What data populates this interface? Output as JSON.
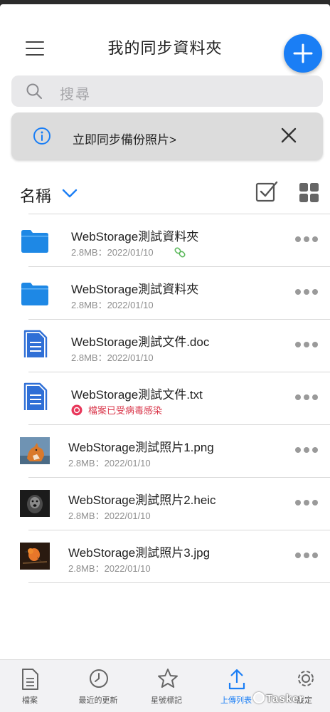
{
  "header": {
    "title": "我的同步資料夾"
  },
  "search": {
    "placeholder": "搜尋"
  },
  "banner": {
    "text": "立即同步備份照片>"
  },
  "sort": {
    "label": "名稱"
  },
  "files": [
    {
      "name": "WebStorage測試資料夾",
      "meta": "2.8MB：2022/01/10",
      "type": "folder",
      "shared": true
    },
    {
      "name": "WebStorage測試資料夾",
      "meta": "2.8MB：2022/01/10",
      "type": "folder",
      "shared": false
    },
    {
      "name": "WebStorage測試文件.doc",
      "meta": "2.8MB：2022/01/10",
      "type": "document"
    },
    {
      "name": "WebStorage測試文件.txt",
      "warning": "檔案已受病毒感染",
      "type": "document"
    },
    {
      "name": "WebStorage測試照片1.png",
      "meta": "2.8MB：2022/01/10",
      "type": "photo",
      "thumb": "fox"
    },
    {
      "name": "WebStorage測試照片2.heic",
      "meta": "2.8MB：2022/01/10",
      "type": "photo",
      "thumb": "dog"
    },
    {
      "name": "WebStorage測試照片3.jpg",
      "meta": "2.8MB：2022/01/10",
      "type": "photo",
      "thumb": "bird"
    }
  ],
  "nav": {
    "tabs": [
      {
        "label": "檔案",
        "icon": "document-icon"
      },
      {
        "label": "最近的更新",
        "icon": "clock-icon"
      },
      {
        "label": "星號標記",
        "icon": "star-icon"
      },
      {
        "label": "上傳列表",
        "icon": "upload-icon",
        "active": true
      },
      {
        "label": "設定",
        "icon": "gear-icon"
      }
    ]
  },
  "watermark": "Tasker",
  "colors": {
    "accent": "#1a7ef5",
    "warning": "#d9364a",
    "folder": "#1e88e5"
  }
}
